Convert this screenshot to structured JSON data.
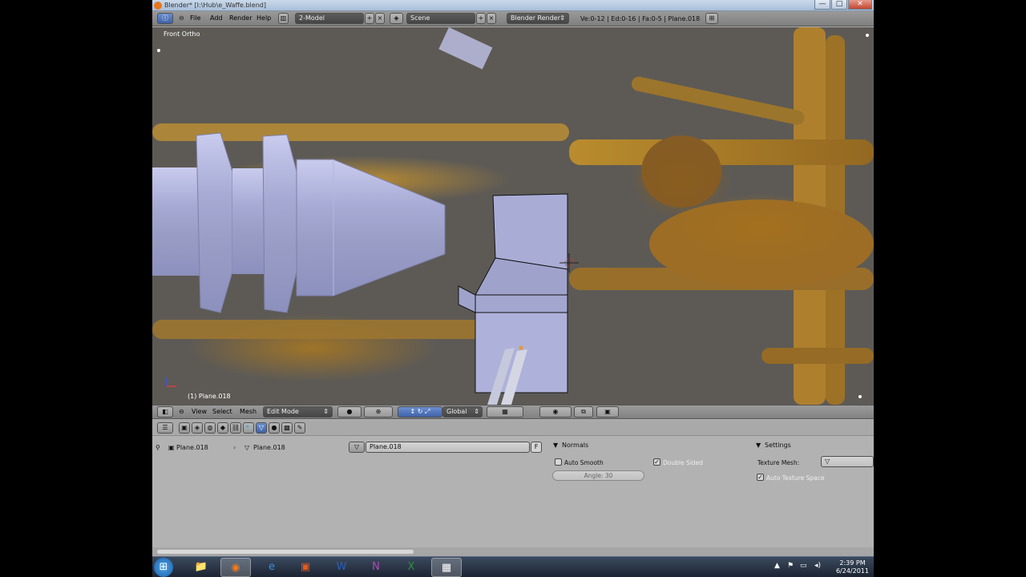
{
  "window": {
    "title": "Blender* [I:\\Hub\\e_Waffe.blend]",
    "minimize": "—",
    "maximize": "□",
    "close": "✕"
  },
  "info_header": {
    "menus": [
      "File",
      "Add",
      "Render",
      "Help"
    ],
    "screen_layout": "2-Model",
    "scene": "Scene",
    "render_engine": "Blender Render",
    "stats": "Ve:0-12 | Ed:0-16 | Fa:0-5 | Plane.018"
  },
  "viewport": {
    "view_label": "Front Ortho",
    "object_label": "(1) Plane.018"
  },
  "view3d_header": {
    "menus": [
      "View",
      "Select",
      "Mesh"
    ],
    "mode": "Edit Mode",
    "orientation": "Global"
  },
  "properties": {
    "breadcrumb": [
      "Plane.018",
      "Plane.018"
    ],
    "mesh_name": "Plane.018",
    "fake_user": "F",
    "normals_panel": {
      "title": "Normals",
      "auto_smooth": "Auto Smooth",
      "auto_smooth_checked": false,
      "double_sided": "Double Sided",
      "double_sided_checked": true,
      "angle": "Angle: 30"
    },
    "settings_panel": {
      "title": "Settings",
      "texture_mesh_label": "Texture Mesh:",
      "auto_texture_space": "Auto Texture Space",
      "auto_texture_space_checked": true
    }
  },
  "taskbar": {
    "time": "2:39 PM",
    "date": "6/24/2011"
  },
  "colors": {
    "mesh_face": "#a9add6",
    "background_gold": "#b98b32",
    "viewport_grey": "#5d5a55"
  }
}
